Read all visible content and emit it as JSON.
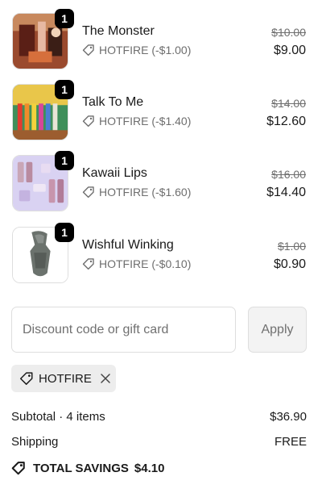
{
  "items": [
    {
      "name": "The Monster",
      "quantity": "1",
      "discount": "HOTFIRE (-$1.00)",
      "original_price": "$10.00",
      "price": "$9.00"
    },
    {
      "name": "Talk To Me",
      "quantity": "1",
      "discount": "HOTFIRE (-$1.40)",
      "original_price": "$14.00",
      "price": "$12.60"
    },
    {
      "name": "Kawaii Lips",
      "quantity": "1",
      "discount": "HOTFIRE (-$1.60)",
      "original_price": "$16.00",
      "price": "$14.40"
    },
    {
      "name": "Wishful Winking",
      "quantity": "1",
      "discount": "HOTFIRE (-$0.10)",
      "original_price": "$1.00",
      "price": "$0.90"
    }
  ],
  "discount_form": {
    "placeholder": "Discount code or gift card",
    "value": "",
    "apply_label": "Apply"
  },
  "applied_code": {
    "label": "HOTFIRE",
    "icon": "tag-icon",
    "remove_icon": "close-icon"
  },
  "summary": {
    "subtotal_label": "Subtotal · 4 items",
    "subtotal_value": "$36.90",
    "shipping_label": "Shipping",
    "shipping_value": "FREE",
    "savings_label": "TOTAL SAVINGS",
    "savings_value": "$4.10"
  },
  "colors": {
    "text": "#1a1a1a",
    "muted": "#6e6e6e",
    "border": "#dedede",
    "badge": "#000000",
    "chip_bg": "#ededed",
    "apply_bg": "#f3f3f3"
  }
}
